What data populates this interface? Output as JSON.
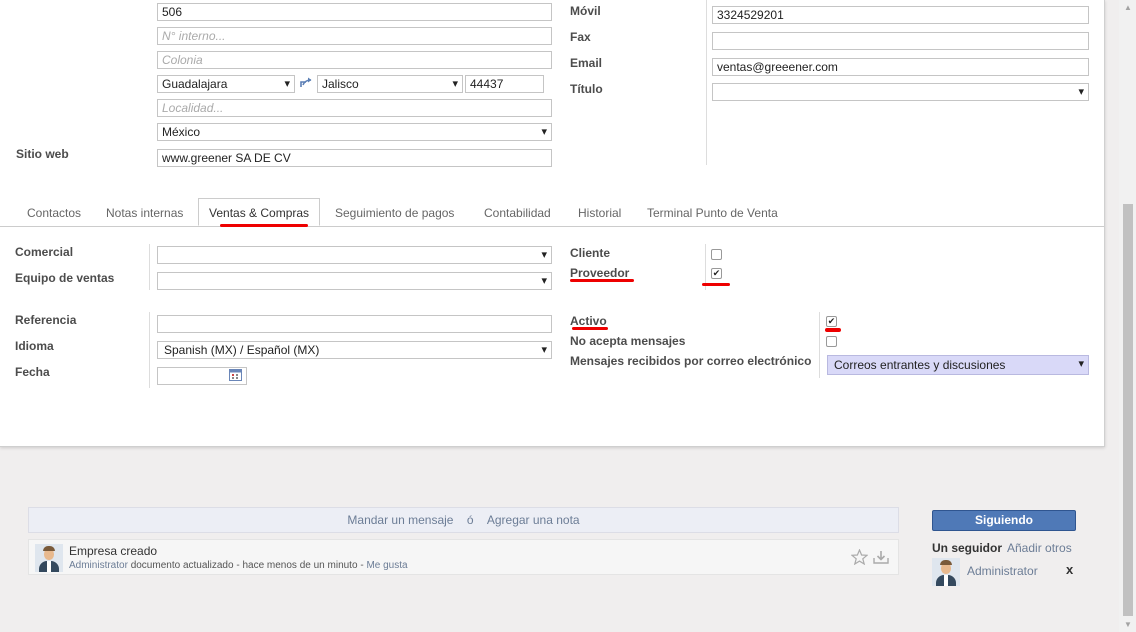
{
  "address": {
    "street_number": "506",
    "interior_placeholder": "N° interno...",
    "colonia_placeholder": "Colonia",
    "city": "Guadalajara",
    "state": "Jalisco",
    "zip": "44437",
    "locality_placeholder": "Localidad...",
    "country": "México"
  },
  "website": {
    "label": "Sitio web",
    "value": "www.greener SA DE CV"
  },
  "contact": {
    "mobile_label": "Móvil",
    "mobile_value": "3324529201",
    "fax_label": "Fax",
    "fax_value": "",
    "email_label": "Email",
    "email_value": "ventas@greeener.com",
    "title_label": "Título",
    "title_value": ""
  },
  "tabs": [
    "Contactos",
    "Notas internas",
    "Ventas & Compras",
    "Seguimiento de pagos",
    "Contabilidad",
    "Historial",
    "Terminal Punto de Venta"
  ],
  "active_tab": "Ventas & Compras",
  "sales": {
    "comercial_label": "Comercial",
    "comercial_value": "",
    "team_label": "Equipo de ventas",
    "team_value": "",
    "reference_label": "Referencia",
    "reference_value": "",
    "language_label": "Idioma",
    "language_value": "Spanish (MX) / Español (MX)",
    "date_label": "Fecha",
    "date_value": ""
  },
  "flags": {
    "cliente_label": "Cliente",
    "cliente_checked": false,
    "proveedor_label": "Proveedor",
    "proveedor_checked": true,
    "activo_label": "Activo",
    "activo_checked": true,
    "no_msg_label": "No acepta mensajes",
    "no_msg_checked": false,
    "email_msgs_label": "Mensajes recibidos por correo electrónico",
    "email_msgs_value": "Correos entrantes y discusiones"
  },
  "chatter": {
    "send_message": "Mandar un mensaje",
    "separator": "ó",
    "add_note": "Agregar una nota",
    "message": {
      "title": "Empresa creado",
      "author": "Administrator",
      "body": "documento actualizado",
      "time": "hace menos de un minuto",
      "like": "Me gusta"
    }
  },
  "followers": {
    "button": "Siguiendo",
    "count_label": "Un seguidor",
    "add_others": "Añadir otros",
    "items": [
      {
        "name": "Administrator",
        "remove": "x"
      }
    ]
  },
  "colors": {
    "accent": "#4f79b7",
    "highlight": "#e00000",
    "select_bg": "#d9d9f8"
  }
}
